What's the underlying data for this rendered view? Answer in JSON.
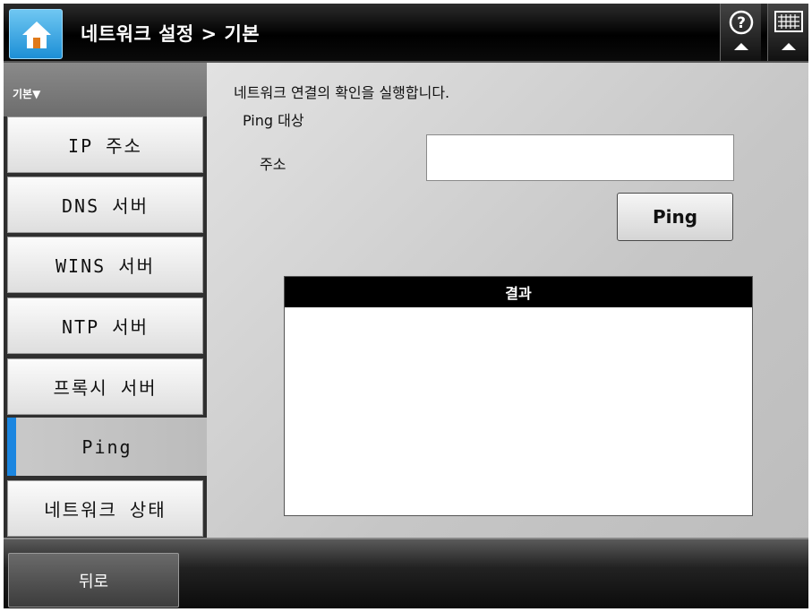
{
  "header": {
    "title": "네트워크 설정 > 기본",
    "home_icon": "home-icon",
    "help_icon": "help-icon",
    "keyboard_icon": "keyboard-icon"
  },
  "sidebar": {
    "header_label": "기본▼",
    "items": [
      {
        "label": "IP 주소"
      },
      {
        "label": "DNS 서버"
      },
      {
        "label": "WINS 서버"
      },
      {
        "label": "NTP 서버"
      },
      {
        "label": "프록시 서버"
      },
      {
        "label": "Ping",
        "active": true
      },
      {
        "label": "네트워크 상태"
      }
    ]
  },
  "main": {
    "description": "네트워크 연결의 확인을 실행합니다.",
    "ping_target_label": "Ping 대상",
    "address_label": "주소",
    "address_value": "",
    "ping_button_label": "Ping",
    "result_header": "결과",
    "result_text": ""
  },
  "footer": {
    "back_label": "뒤로"
  },
  "colors": {
    "accent": "#1b86e0",
    "home_button": "#2a9be0"
  }
}
